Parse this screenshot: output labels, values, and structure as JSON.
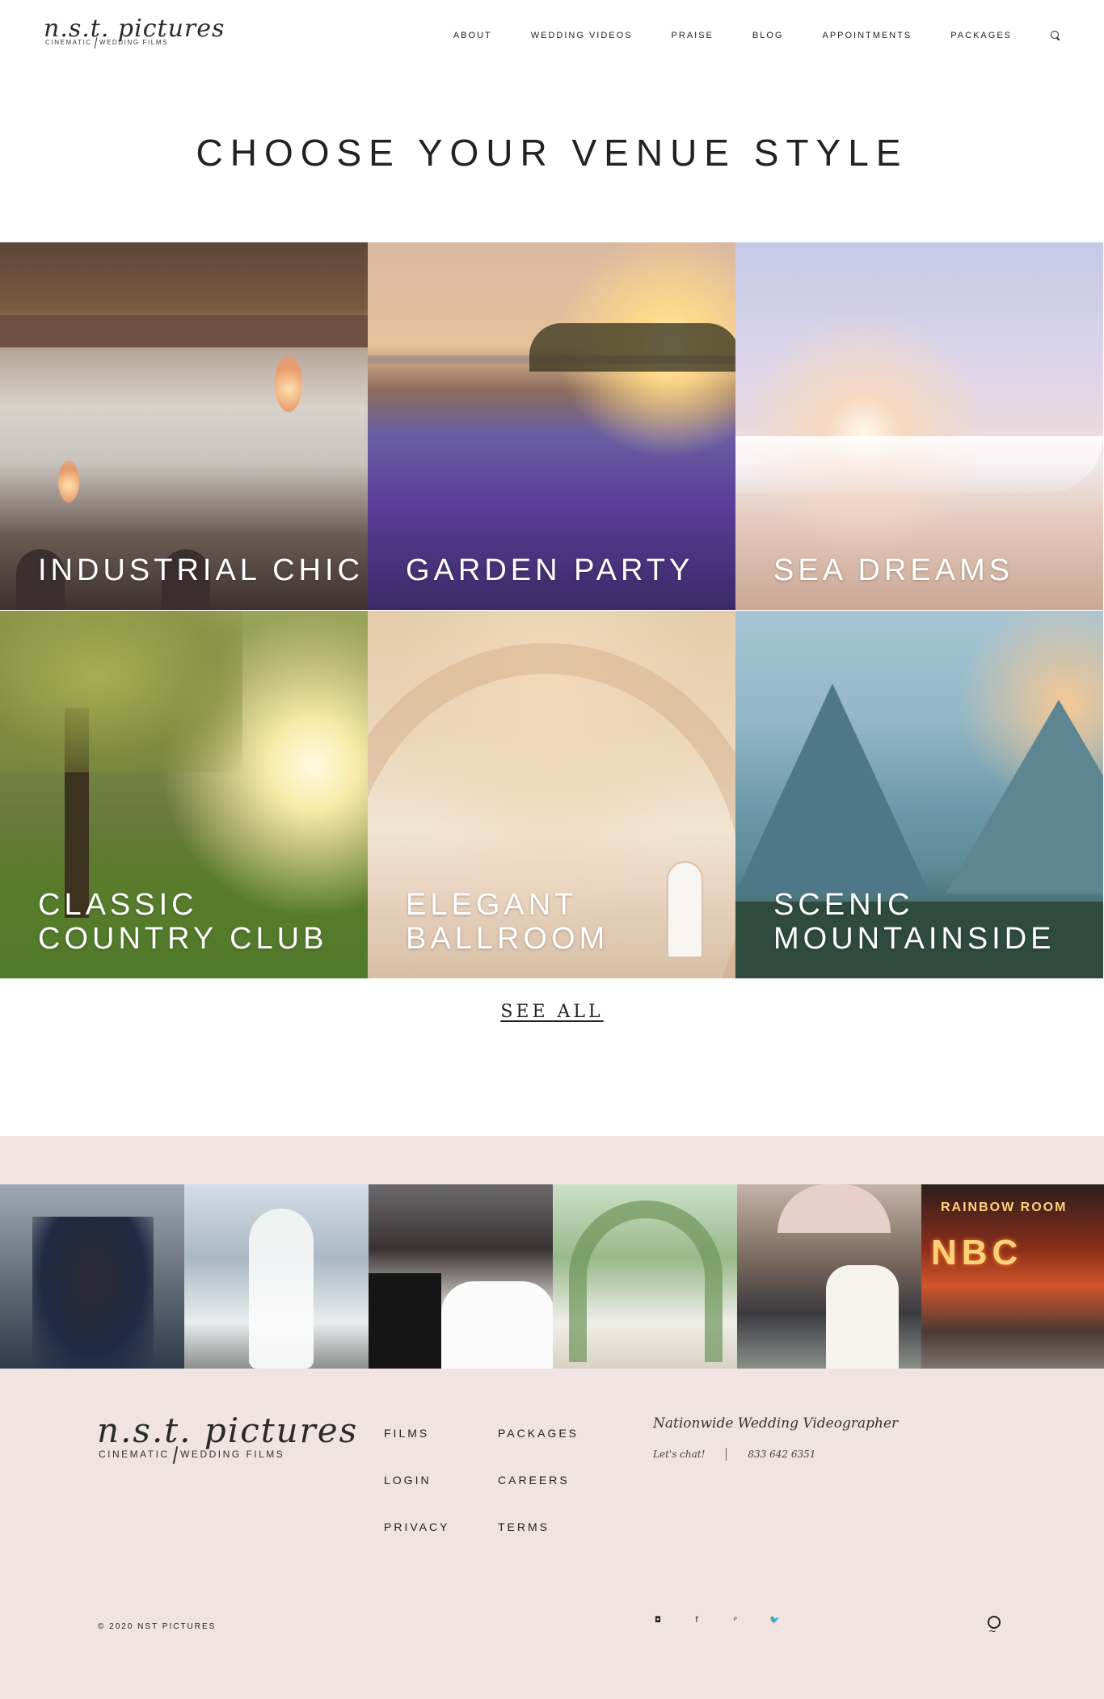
{
  "header": {
    "logo": {
      "script": "n.s.t. pictures",
      "left": "CINEMATIC",
      "right": "WEDDING FILMS"
    },
    "nav": [
      "ABOUT",
      "WEDDING VIDEOS",
      "PRAISE",
      "BLOG",
      "APPOINTMENTS",
      "PACKAGES"
    ],
    "search_icon": "search-icon"
  },
  "main": {
    "title": "CHOOSE YOUR VENUE STYLE",
    "venues": [
      {
        "label": "INDUSTRIAL CHIC"
      },
      {
        "label": "GARDEN PARTY"
      },
      {
        "label": "SEA DREAMS"
      },
      {
        "label": "CLASSIC\nCOUNTRY CLUB"
      },
      {
        "label": "ELEGANT\nBALLROOM"
      },
      {
        "label": "SCENIC\nMOUNTAINSIDE"
      }
    ],
    "see_all": "SEE ALL"
  },
  "instagram": {
    "photos": [
      "wedding-couple-kiss",
      "bride-by-water",
      "couple-portrait",
      "floral-arch-bride",
      "couple-umbrella-kiss",
      "nbc-studios-sign"
    ],
    "neon_top": "RAINBOW ROOM",
    "neon_main": "NBC"
  },
  "footer": {
    "logo": {
      "script": "n.s.t. pictures",
      "left": "CINEMATIC",
      "right": "WEDDING FILMS"
    },
    "links": [
      "FILMS",
      "PACKAGES",
      "LOGIN",
      "CAREERS",
      "PRIVACY",
      "TERMS"
    ],
    "tagline": "Nationwide Wedding Videographer",
    "chat": "Let's chat!",
    "phone": "833 642 6351",
    "copyright": "© 2020 NST PICTURES",
    "social": [
      "instagram-icon",
      "facebook-icon",
      "pinterest-icon",
      "twitter-icon"
    ],
    "social_glyphs": [
      "◘",
      "f",
      "ᵖ",
      "🐦"
    ]
  },
  "colors": {
    "band": "#efe4e2",
    "text": "#222222"
  }
}
